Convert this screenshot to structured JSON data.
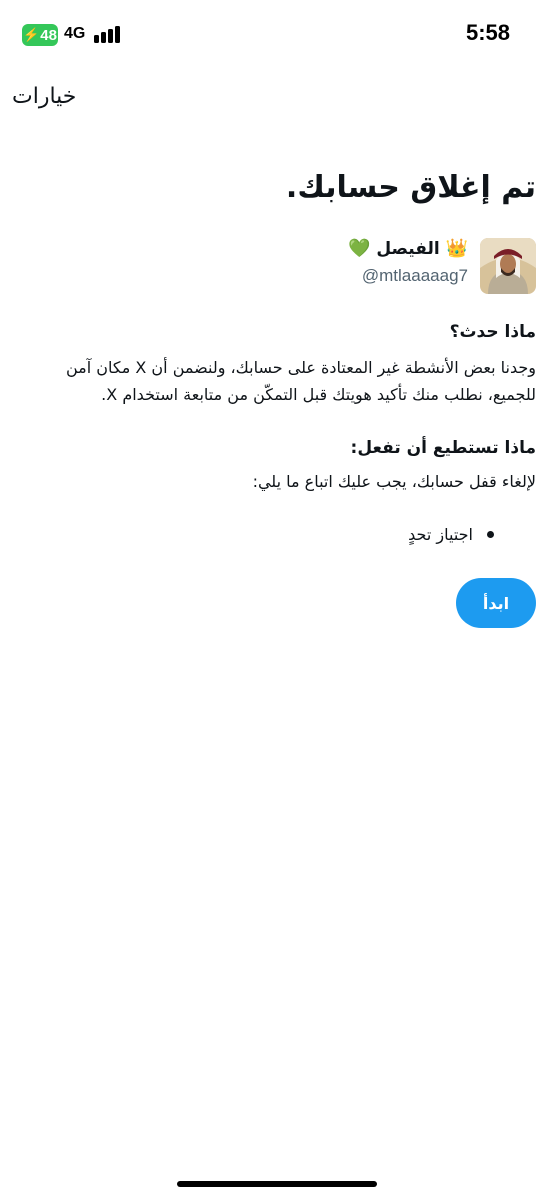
{
  "status_bar": {
    "battery": "48",
    "network": "4G",
    "time": "5:58",
    "battery_color": "#34c759"
  },
  "header": {
    "options_label": "خيارات"
  },
  "main": {
    "title": "تم إغلاق حسابك.",
    "profile": {
      "display_name": "الفيصل",
      "crown_emoji": "👑",
      "heart_emoji": "💚",
      "username": "@mtlaaaaag7"
    },
    "what_happened": {
      "heading": "ماذا حدث؟",
      "text": "وجدنا بعض الأنشطة غير المعتادة على حسابك، ولنضمن أن X مكان آمن للجميع، نطلب منك تأكيد هويتك قبل التمكّن من متابعة استخدام X."
    },
    "what_to_do": {
      "heading": "ماذا تستطيع أن تفعل:",
      "text": "لإلغاء قفل حسابك، يجب عليك اتباع ما يلي:",
      "items": [
        "اجتياز تحدٍ"
      ]
    },
    "start_button_label": "ابدأ",
    "accent_color": "#1d9bf0"
  }
}
